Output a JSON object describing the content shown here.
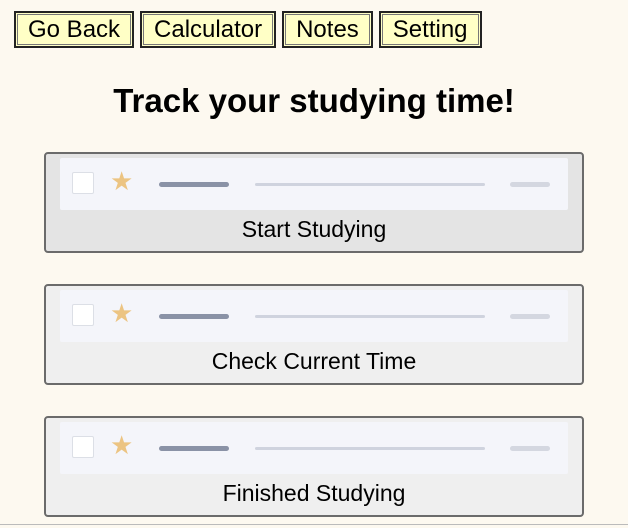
{
  "nav": {
    "go_back": "Go Back",
    "calculator": "Calculator",
    "notes": "Notes",
    "setting": "Setting"
  },
  "title": "Track your studying time!",
  "cards": [
    {
      "label": "Start Studying"
    },
    {
      "label": "Check Current Time"
    },
    {
      "label": "Finished Studying"
    }
  ],
  "colors": {
    "background": "#fdf9f0",
    "nav_button": "#ffffc6",
    "star": "#ecc482"
  },
  "icons": {
    "star": "star-icon",
    "checkbox": "checkbox-icon"
  }
}
